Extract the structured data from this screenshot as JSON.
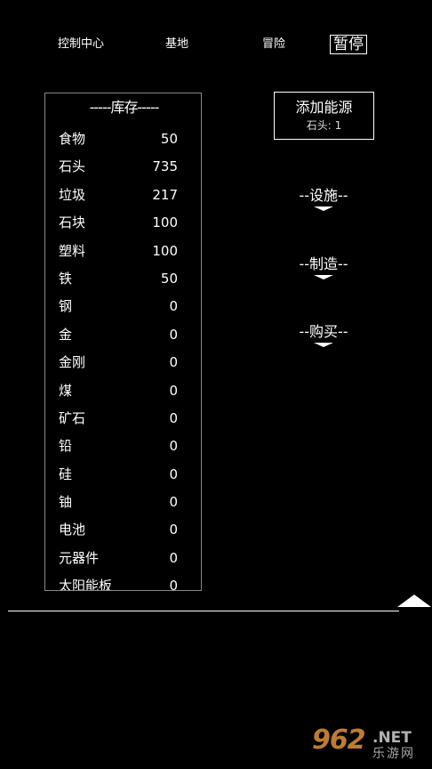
{
  "nav": {
    "control_center": "控制中心",
    "base": "基地",
    "adventure": "冒险",
    "pause": "暂停"
  },
  "inventory": {
    "title": "-----库存-----",
    "items": [
      {
        "name": "食物",
        "qty": "50"
      },
      {
        "name": "石头",
        "qty": "735"
      },
      {
        "name": "垃圾",
        "qty": "217"
      },
      {
        "name": "石块",
        "qty": "100"
      },
      {
        "name": "塑料",
        "qty": "100"
      },
      {
        "name": "铁",
        "qty": "50"
      },
      {
        "name": "钢",
        "qty": "0"
      },
      {
        "name": "金",
        "qty": "0"
      },
      {
        "name": "金刚",
        "qty": "0"
      },
      {
        "name": "煤",
        "qty": "0"
      },
      {
        "name": "矿石",
        "qty": "0"
      },
      {
        "name": "铅",
        "qty": "0"
      },
      {
        "name": "硅",
        "qty": "0"
      },
      {
        "name": "铀",
        "qty": "0"
      },
      {
        "name": "电池",
        "qty": "0"
      },
      {
        "name": "元器件",
        "qty": "0"
      },
      {
        "name": "太阳能板",
        "qty": "0"
      }
    ]
  },
  "add_energy": {
    "label": "添加能源",
    "cost": "石头: 1"
  },
  "sections": {
    "facilities": "--设施--",
    "crafting": "--制造--",
    "purchase": "--购买--"
  },
  "watermark": {
    "number": "962",
    "domain": ".NET",
    "site": "乐游网"
  }
}
